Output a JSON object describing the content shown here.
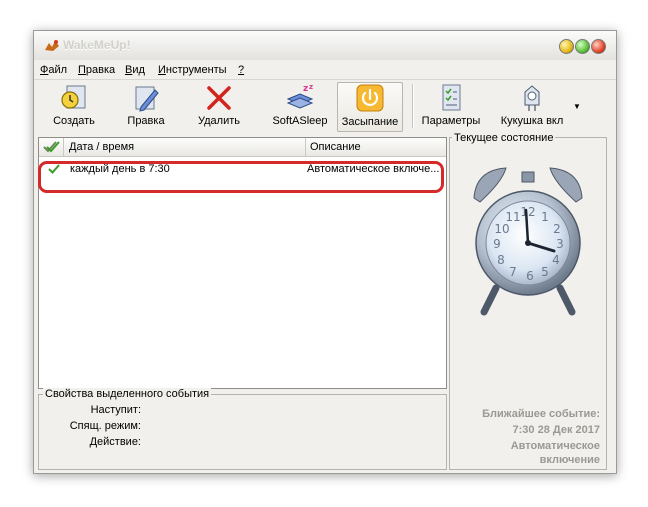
{
  "window": {
    "title": "WakeMeUp!"
  },
  "menu": {
    "items": [
      {
        "underline": "Ф",
        "rest": "айл"
      },
      {
        "underline": "П",
        "rest": "равка"
      },
      {
        "underline": "В",
        "rest": "ид"
      },
      {
        "underline": "И",
        "rest": "нструменты"
      },
      {
        "underline": "?",
        "rest": ""
      }
    ]
  },
  "toolbar": {
    "buttons": [
      {
        "label": "Создать",
        "icon": "clock-create-icon"
      },
      {
        "label": "Правка",
        "icon": "pencil-icon"
      },
      {
        "label": "Удалить",
        "icon": "delete-x-icon"
      },
      {
        "label": "SoftASleep",
        "icon": "sleep-icon"
      },
      {
        "label": "Засыпание",
        "icon": "power-icon"
      },
      {
        "label": "Параметры",
        "icon": "checklist-icon"
      },
      {
        "label": "Кукушка вкл",
        "icon": "cuckoo-clock-icon"
      }
    ],
    "dropdown_glyph": "▼"
  },
  "list": {
    "columns": [
      "Дата / время",
      "Описание"
    ],
    "rows": [
      {
        "datetime": "каждый день в 7:30",
        "description": "Автоматическое включе..."
      }
    ]
  },
  "properties": {
    "title": "Свойства выделенного события",
    "labels": [
      "Наступит:",
      "Спящ. режим:",
      "Действие:"
    ]
  },
  "state": {
    "title": "Текущее состояние",
    "next_event_label": "Ближайшее событие:",
    "next_event_time": "7:30 28 Дек 2017",
    "next_event_action_line1": "Автоматическое",
    "next_event_action_line2": "включение",
    "clock_numbers": [
      "12",
      "1",
      "2",
      "3",
      "4",
      "5",
      "6",
      "7",
      "8",
      "9",
      "10",
      "11"
    ]
  },
  "colors": {
    "highlight": "#d42a2a",
    "window_bg": "#f1f0ec",
    "check": "#3c9b2a"
  }
}
